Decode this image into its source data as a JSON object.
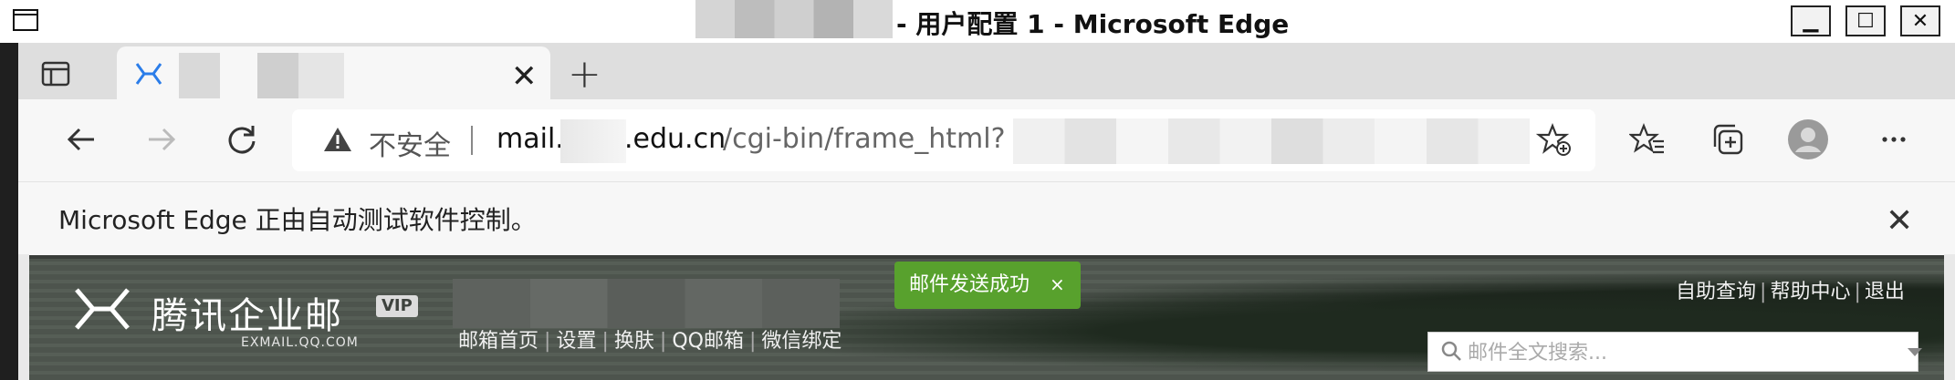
{
  "window": {
    "title": "- 用户配置 1 - Microsoft Edge",
    "minimize": "▁",
    "maximize": "☐",
    "close": "✕"
  },
  "tab": {
    "close": "✕",
    "new": "+"
  },
  "address": {
    "insecure_label": "不安全",
    "url_prefix": "mail.",
    "url_domain": ".edu.cn",
    "url_path": "/cgi-bin/frame_html?"
  },
  "infobar": {
    "message": "Microsoft Edge 正由自动测试软件控制。",
    "close": "✕"
  },
  "mail": {
    "logo_text": "腾讯企业邮",
    "vip": "VIP",
    "logo_sub": "EXMAIL.QQ.COM",
    "nav": [
      "邮箱首页",
      "设置",
      "换肤",
      "QQ邮箱",
      "微信绑定"
    ],
    "toast": "邮件发送成功",
    "toast_close": "×",
    "right_links": [
      "自助查询",
      "帮助中心",
      "退出"
    ],
    "search_placeholder": "邮件全文搜索..."
  },
  "colors": {
    "toast_bg": "#58a12d",
    "tab_icon": "#2b7de9"
  }
}
